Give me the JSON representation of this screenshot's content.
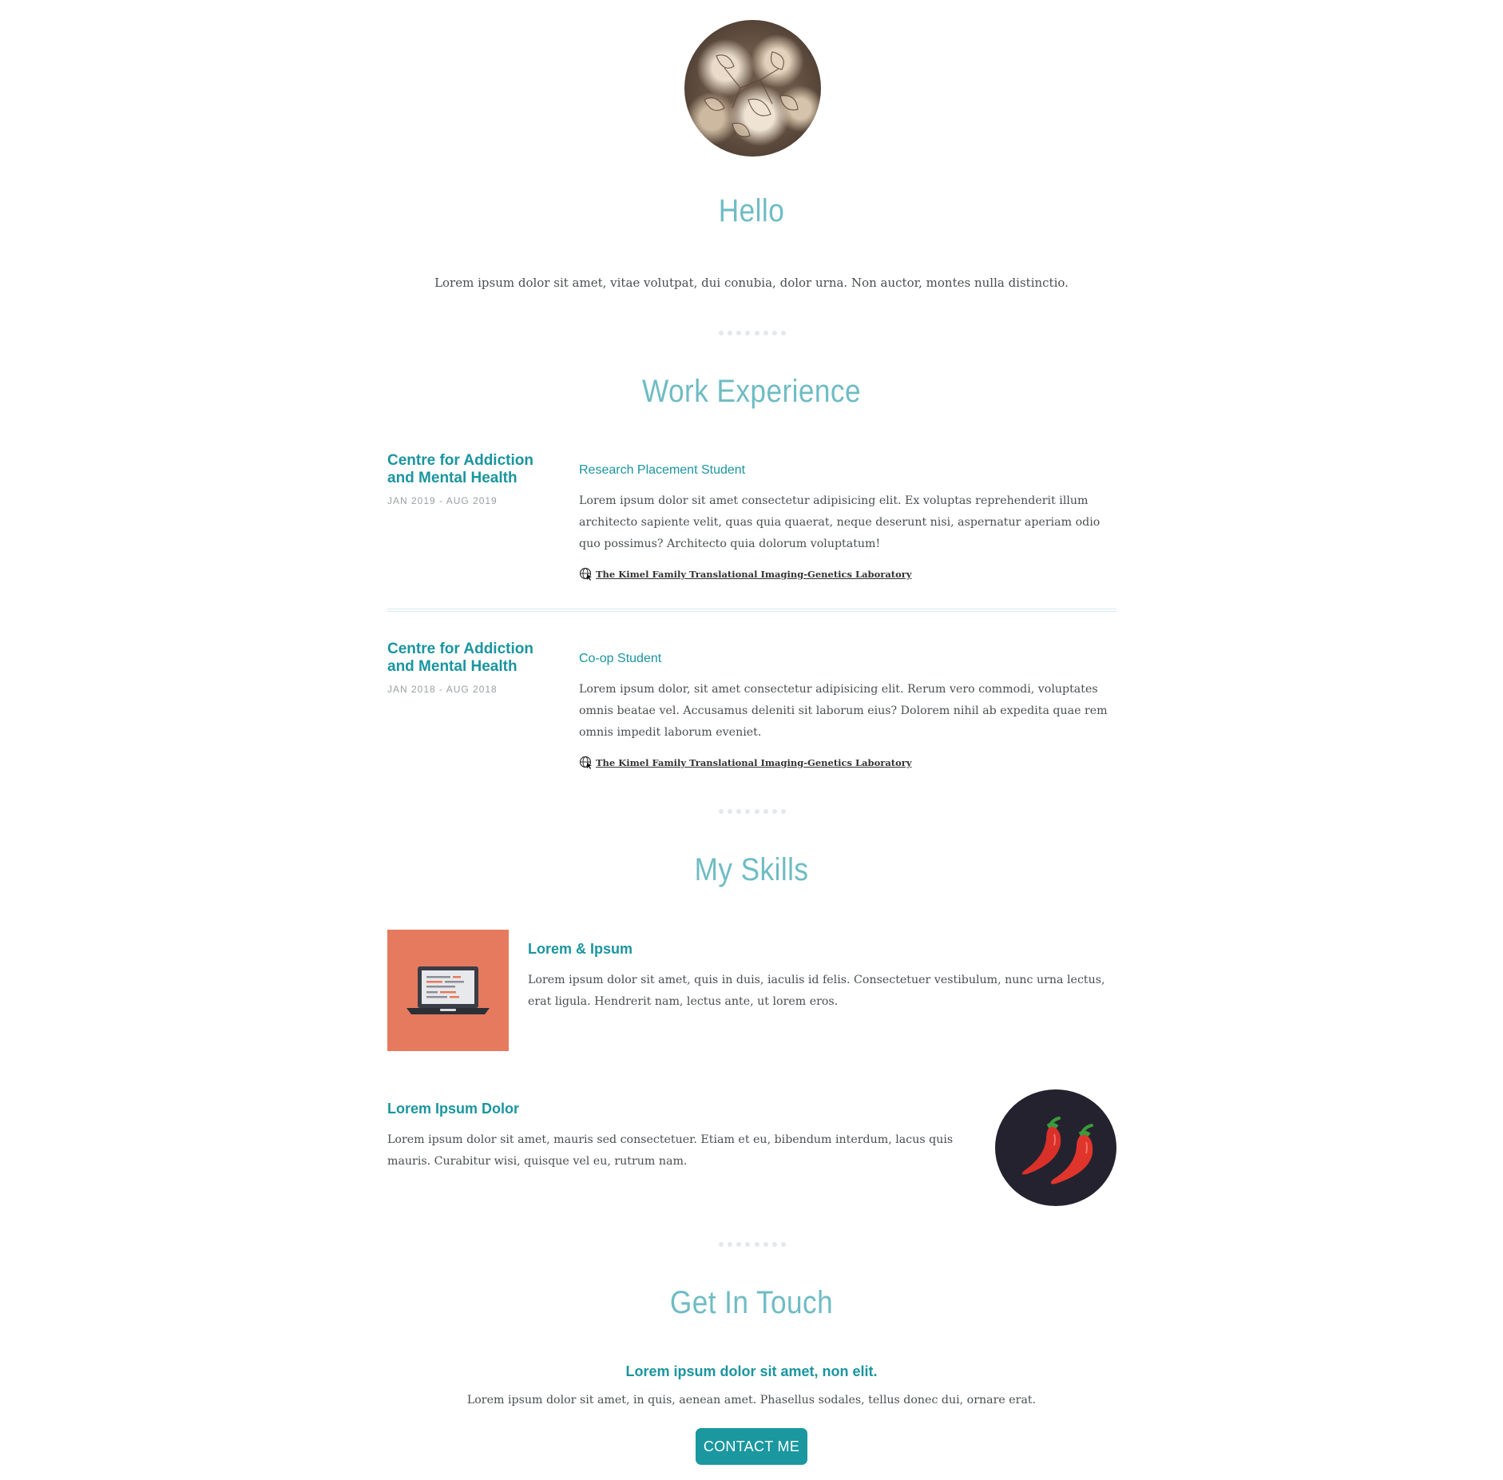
{
  "profile": {
    "avatar_icon": "dried-flower-photo"
  },
  "hello": {
    "title": "Hello",
    "text": "Lorem ipsum dolor sit amet, vitae volutpat, dui conubia, dolor urna. Non auctor, montes nulla distinctio."
  },
  "work": {
    "title": "Work Experience",
    "jobs": [
      {
        "company": "Centre for Addiction and Mental Health",
        "dates": "JAN 2019 - AUG 2019",
        "role": "Research Placement Student",
        "description": "Lorem ipsum dolor sit amet consectetur adipisicing elit. Ex voluptas reprehenderit illum architecto sapiente velit, quas quia quaerat, neque deserunt nisi, aspernatur aperiam odio quo possimus? Architecto quia dolorum voluptatum!",
        "link": "The Kimel Family Translational Imaging-Genetics Laboratory"
      },
      {
        "company": "Centre for Addiction and Mental Health",
        "dates": "JAN 2018 - AUG 2018",
        "role": "Co-op Student",
        "description": "Lorem ipsum dolor, sit amet consectetur adipisicing elit. Rerum vero commodi, voluptates omnis beatae vel. Accusamus deleniti sit laborum eius? Dolorem nihil ab expedita quae rem omnis impedit laborum eveniet.",
        "link": "The Kimel Family Translational Imaging-Genetics Laboratory"
      }
    ]
  },
  "skills": {
    "title": "My Skills",
    "items": [
      {
        "title": "Lorem & Ipsum",
        "description": "Lorem ipsum dolor sit amet, quis in duis, iaculis id felis. Consectetuer vestibulum, nunc urna lectus, erat ligula. Hendrerit nam, lectus ante, ut lorem eros.",
        "icon": "laptop-icon",
        "color": "#e57a5e"
      },
      {
        "title": "Lorem Ipsum Dolor",
        "description": "Lorem ipsum dolor sit amet, mauris sed consectetuer. Etiam et eu, bibendum interdum, lacus quis mauris. Curabitur wisi, quisque vel eu, rutrum nam.",
        "icon": "chili-peppers-icon",
        "color": "#24222f"
      }
    ]
  },
  "contact": {
    "title": "Get In Touch",
    "subtitle": "Lorem ipsum dolor sit amet, non elit.",
    "text": "Lorem ipsum dolor sit amet, in quis, aenean amet. Phasellus sodales, tellus donec dui, ornare erat.",
    "button_label": "CONTACT ME"
  },
  "colors": {
    "heading": "#6fbcc4",
    "accent": "#1a95a0",
    "button": "#1a979f"
  }
}
